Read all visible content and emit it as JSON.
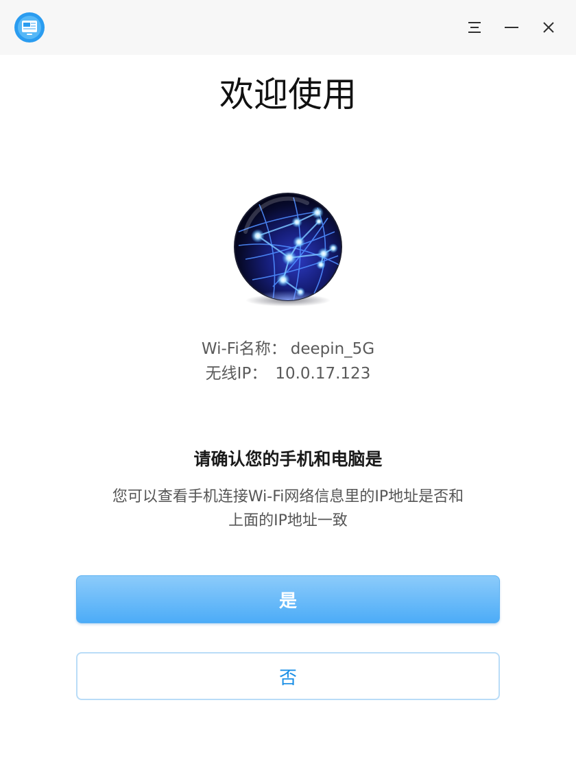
{
  "window": {
    "controls": {
      "menu_icon": "hamburger-menu-icon",
      "minimize_icon": "minimize-icon",
      "close_icon": "close-icon"
    },
    "app_icon": "phone-to-pc-transfer-app-icon"
  },
  "main": {
    "heading": "欢迎使用",
    "hero_icon": "network-globe-icon",
    "wifi_label": "Wi-Fi名称：",
    "wifi_value": "deepin_5G",
    "ip_label": "无线IP：",
    "ip_value": "10.0.17.123",
    "confirm_title": "请确认您的手机和电脑是",
    "description_line1": "您可以查看手机连接Wi-Fi网络信息里的IP地址是否和",
    "description_line2": "上面的IP地址一致"
  },
  "buttons": {
    "yes_label": "是",
    "no_label": "否"
  },
  "colors": {
    "primary_button_top": "#8ccbfa",
    "primary_button_bottom": "#4cacf8",
    "secondary_button_text": "#1b8fe6",
    "secondary_button_border": "#b9dcf7",
    "titlebar_bg": "#f7f7f7"
  }
}
